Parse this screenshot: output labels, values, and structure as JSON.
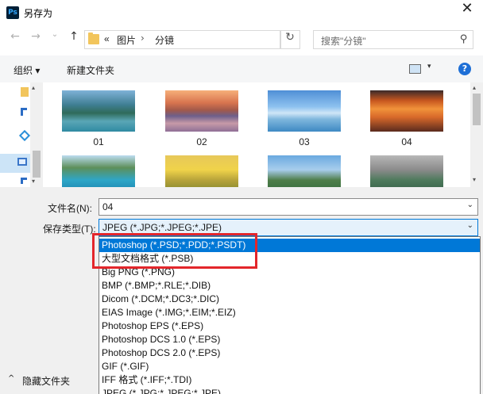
{
  "window": {
    "app_icon": "photoshop-app-icon",
    "app_icon_text": "Ps",
    "title": "另存为",
    "close_glyph": "✕"
  },
  "nav": {
    "back_glyph": "←",
    "forward_glyph": "→",
    "dropdown_glyph": "⌄",
    "up_glyph": "↑",
    "overflow_glyph": "«",
    "breadcrumb": [
      "图片",
      "分镜"
    ],
    "separator_glyph": "›",
    "address_dropdown_glyph": "⌄",
    "refresh_glyph": "↻",
    "search_placeholder": "搜索\"分镜\"",
    "search_glyph": "⚲"
  },
  "toolbar": {
    "organize_label": "组织 ▾",
    "new_folder_label": "新建文件夹",
    "view_dropdown_glyph": "▾",
    "help_glyph": "?"
  },
  "sidebar": {
    "scroll_up": "▴",
    "scroll_down": "▾"
  },
  "files": [
    {
      "name": "01"
    },
    {
      "name": "02"
    },
    {
      "name": "03"
    },
    {
      "name": "04"
    },
    {
      "name": ""
    },
    {
      "name": ""
    },
    {
      "name": ""
    },
    {
      "name": ""
    }
  ],
  "scroll": {
    "up": "▴",
    "down": "▾"
  },
  "form": {
    "filename_label": "文件名(N):",
    "filename_value": "04",
    "filename_chevron": "⌄",
    "type_label": "保存类型(T):",
    "type_value": "JPEG (*.JPG;*.JPEG;*.JPE)",
    "type_chevron": "⌄",
    "hide_folders_arrow": "^",
    "hide_folders_label": "隐藏文件夹"
  },
  "type_options": [
    "Photoshop (*.PSD;*.PDD;*.PSDT)",
    "大型文档格式 (*.PSB)",
    "Big PNG (*.PNG)",
    "BMP (*.BMP;*.RLE;*.DIB)",
    "Dicom (*.DCM;*.DC3;*.DIC)",
    "EIAS Image (*.IMG;*.EIM;*.EIZ)",
    "Photoshop EPS (*.EPS)",
    "Photoshop DCS 1.0 (*.EPS)",
    "Photoshop DCS 2.0 (*.EPS)",
    "GIF (*.GIF)",
    "IFF 格式 (*.IFF;*.TDI)",
    "JPEG (*.JPG;*.JPEG;*.JPE)"
  ],
  "selected_option_index": 0,
  "highlight_color": "#e3262b",
  "accent_color": "#0078d7"
}
